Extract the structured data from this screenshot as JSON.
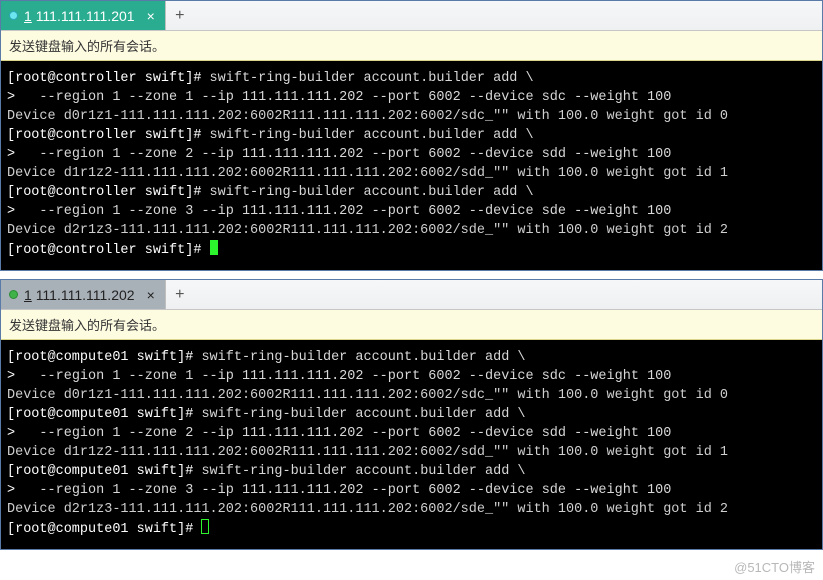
{
  "sessions": [
    {
      "tab_prefix": "1",
      "tab_host": "111.111.111.201",
      "tab_close": "×",
      "tab_add": "+",
      "hint": "发送键盘输入的所有会话。",
      "prompt_open": "[root@controller swift]#",
      "cont": ">",
      "lines": {
        "l0": "swift-ring-builder account.builder add \\",
        "l1": "  --region 1 --zone 1 --ip 111.111.111.202 --port 6002 --device sdc --weight 100",
        "l2": "Device d0r1z1-111.111.111.202:6002R111.111.111.202:6002/sdc_\"\" with 100.0 weight got id 0",
        "l3": "swift-ring-builder account.builder add \\",
        "l4": "  --region 1 --zone 2 --ip 111.111.111.202 --port 6002 --device sdd --weight 100",
        "l5": "Device d1r1z2-111.111.111.202:6002R111.111.111.202:6002/sdd_\"\" with 100.0 weight got id 1",
        "l6": "swift-ring-builder account.builder add \\",
        "l7": "  --region 1 --zone 3 --ip 111.111.111.202 --port 6002 --device sde --weight 100",
        "l8": "Device d2r1z3-111.111.111.202:6002R111.111.111.202:6002/sde_\"\" with 100.0 weight got id 2"
      }
    },
    {
      "tab_prefix": "1",
      "tab_host": "111.111.111.202",
      "tab_close": "×",
      "tab_add": "+",
      "hint": "发送键盘输入的所有会话。",
      "prompt_open": "[root@compute01 swift]#",
      "cont": ">",
      "lines": {
        "l0": "swift-ring-builder account.builder add \\",
        "l1": "  --region 1 --zone 1 --ip 111.111.111.202 --port 6002 --device sdc --weight 100",
        "l2": "Device d0r1z1-111.111.111.202:6002R111.111.111.202:6002/sdc_\"\" with 100.0 weight got id 0",
        "l3": "swift-ring-builder account.builder add \\",
        "l4": "  --region 1 --zone 2 --ip 111.111.111.202 --port 6002 --device sdd --weight 100",
        "l5": "Device d1r1z2-111.111.111.202:6002R111.111.111.202:6002/sdd_\"\" with 100.0 weight got id 1",
        "l6": "swift-ring-builder account.builder add \\",
        "l7": "  --region 1 --zone 3 --ip 111.111.111.202 --port 6002 --device sde --weight 100",
        "l8": "Device d2r1z3-111.111.111.202:6002R111.111.111.202:6002/sde_\"\" with 100.0 weight got id 2"
      }
    }
  ],
  "watermark": "@51CTO博客"
}
